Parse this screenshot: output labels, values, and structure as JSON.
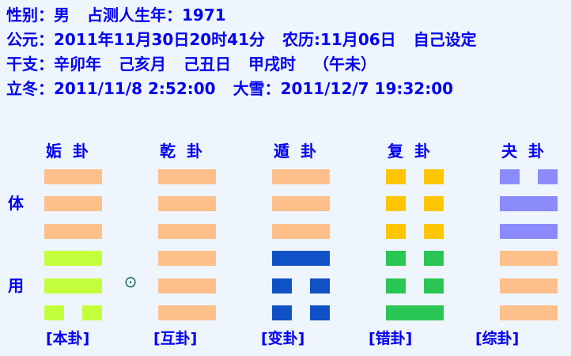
{
  "info": {
    "gender_label": "性别：",
    "gender_value": "男",
    "birth_year_label": "占测人生年：",
    "birth_year_value": "1971",
    "solar_label": "公元：",
    "solar_value": "2011年11月30日20时41分",
    "lunar_label": "农历:",
    "lunar_value": "11月06日",
    "set_by": "自己设定",
    "ganzhi_label": "干支：",
    "ganzhi_year": "辛卯年",
    "ganzhi_month": "己亥月",
    "ganzhi_day": "己丑日",
    "ganzhi_hour": "甲戌时",
    "ganzhi_void": "（午未）",
    "term1_label": "立冬：",
    "term1_value": "2011/11/8 2:52:00",
    "term2_label": "大雪：",
    "term2_value": "2011/12/7 19:32:00"
  },
  "side_labels": {
    "ti": "体",
    "yong": "用"
  },
  "moving_mark": "⊙",
  "hexagrams": [
    {
      "title": "姤卦",
      "caption": "[本卦]",
      "lines": [
        "yang",
        "yang",
        "yang",
        "yang",
        "yang",
        "yin"
      ],
      "colors": [
        "#fdc08b",
        "#fdc08b",
        "#fdc08b",
        "#c4ff3c",
        "#c4ff3c",
        "#c4ff3c"
      ]
    },
    {
      "title": "乾卦",
      "caption": "[互卦]",
      "lines": [
        "yang",
        "yang",
        "yang",
        "yang",
        "yang",
        "yang"
      ],
      "colors": [
        "#fdc08b",
        "#fdc08b",
        "#fdc08b",
        "#fdc08b",
        "#fdc08b",
        "#fdc08b"
      ]
    },
    {
      "title": "遁卦",
      "caption": "[变卦]",
      "lines": [
        "yang",
        "yang",
        "yang",
        "yang",
        "yin",
        "yin"
      ],
      "colors": [
        "#fdc08b",
        "#fdc08b",
        "#fdc08b",
        "#1052c6",
        "#1052c6",
        "#1052c6"
      ]
    },
    {
      "title": "复卦",
      "caption": "[错卦]",
      "lines": [
        "yin",
        "yin",
        "yin",
        "yin",
        "yin",
        "yang"
      ],
      "colors": [
        "#fdc502",
        "#fdc502",
        "#fdc502",
        "#29c653",
        "#29c653",
        "#29c653"
      ]
    },
    {
      "title": "夬卦",
      "caption": "[综卦]",
      "lines": [
        "yin",
        "yang",
        "yang",
        "yang",
        "yang",
        "yang"
      ],
      "colors": [
        "#8b8bfc",
        "#8b8bfc",
        "#8b8bfc",
        "#fdc08b",
        "#fdc08b",
        "#fdc08b"
      ]
    }
  ]
}
